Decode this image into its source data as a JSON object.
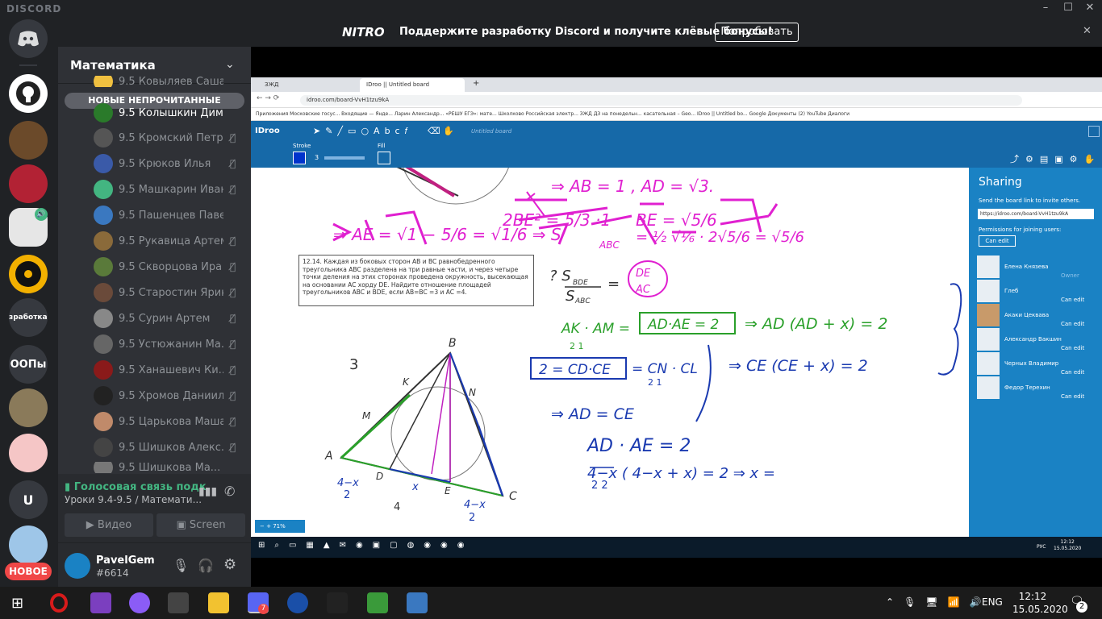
{
  "app": {
    "brand": "DISCORD"
  },
  "nitro": {
    "logo": "NITRO",
    "text": "Поддержите разработку Discord и получите клёвые бонусы!",
    "button": "Попробовать"
  },
  "servers": {
    "labels": [
      "разработкаРи",
      "ООПы",
      "U"
    ],
    "new_badge": "НОВОЕ"
  },
  "channel": {
    "title": "Математика",
    "unread": "НОВЫЕ НЕПРОЧИТАННЫЕ"
  },
  "members": [
    "9.5 Ковыляев Саша",
    "9.5 Колышкин Дима",
    "9.5 Кромский Петр",
    "9.5 Крюков Илья",
    "9.5 Машкарин Иван",
    "9.5 Пашенцев Павел",
    "9.5 Рукавица Артем",
    "9.5 Скворцова Ира",
    "9.5 Старостин Ярик",
    "9.5 Сурин Артем",
    "9.5 Устюжанин Ма...",
    "9.5 Ханашевич Ки...",
    "9.5 Хромов Даниил",
    "9.5 Царькова Маша",
    "9.5 Шишков Алекс...",
    "9.5 Шишкова Ма..."
  ],
  "voice": {
    "status": "Голосовая связь подк",
    "channel": "Уроки 9.4-9.5 / Математи...",
    "video": "Видео",
    "screen": "Screen"
  },
  "user": {
    "name": "PavelGem",
    "tag": "#6614"
  },
  "browser": {
    "tabs": [
      "ЗЖД",
      "IDroo || Untitled board"
    ],
    "url": "idroo.com/board-VvH1tzu9kA",
    "bookmarks": "Приложения   Московские госус...   Входящие — Яндe...   Ларин Александр...   «РЕШУ ЕГЭ»: мате...   Школково   Российская электр...   ЗЖД   ДЗ на понедельн...   касательная – Geo...   IDroo || Untitled bo...   Google Документы   (2) YouTube   Диалоги"
  },
  "idroo": {
    "logo": "IDroo",
    "board": "Untitled board",
    "stroke_label": "Stroke",
    "stroke_value": "3",
    "fill_label": "Fill",
    "zoom": "71%"
  },
  "problem": "12.14. Каждая из боковых сторон AB и BC равнобедренного треугольника ABC разделена на три равные части, и через четыре точки деления на этих сторонах проведена окружность, высекающая на основании AC хорду DE. Найдите отношение площадей треугольников ABC и BDE, если AB=BC =3 и AC =4.",
  "sharing": {
    "title": "Sharing",
    "desc": "Send the board link to invite others.",
    "link": "https://idroo.com/board-VvH1tzu9kA",
    "perm": "Permissions for joining users:",
    "can_edit": "Can edit",
    "people": [
      {
        "name": "Елена Князева",
        "role": "Owner"
      },
      {
        "name": "Глеб",
        "role": "Can edit"
      },
      {
        "name": "Акаки Цеквава",
        "role": "Can edit"
      },
      {
        "name": "Александр Вакшин",
        "role": "Can edit"
      },
      {
        "name": "Черных Владимир",
        "role": "Can edit"
      },
      {
        "name": "Федор Терехин",
        "role": "Can edit"
      }
    ]
  },
  "inner_clock": {
    "time": "12:12",
    "date": "15.05.2020",
    "lang": "РУС"
  },
  "taskbar": {
    "time": "12:12",
    "date": "15.05.2020",
    "lang": "ENG",
    "notif": "2"
  }
}
